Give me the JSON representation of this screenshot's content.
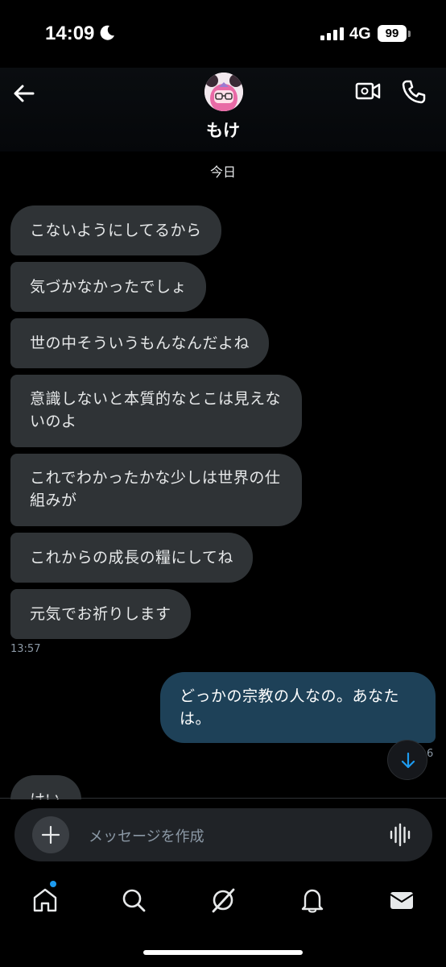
{
  "status_bar": {
    "time": "14:09",
    "network": "4G",
    "battery": "99"
  },
  "header": {
    "contact_name": "もけ"
  },
  "conversation": {
    "date_label": "今日",
    "incoming": [
      "こないようにしてるから",
      "気づかなかったでしょ",
      "世の中そういうもんなんだよね",
      "意識しないと本質的なとこは見えないのよ",
      "これでわかったかな少しは世界の仕組みが",
      "これからの成長の糧にしてね",
      "元気でお祈りします"
    ],
    "incoming_timestamp": "13:57",
    "outgoing": "どっかの宗教の人なの。あなたは。",
    "outgoing_timestamp_partial": "6",
    "partial_incoming": "はい"
  },
  "composer": {
    "placeholder": "メッセージを作成"
  },
  "colors": {
    "incoming_bubble": "#2f3336",
    "outgoing_bubble": "#1e4158",
    "accent": "#1d9bf0"
  },
  "icons": {
    "tabs": [
      "home-icon",
      "search-icon",
      "grok-icon",
      "notifications-icon",
      "messages-icon"
    ]
  }
}
